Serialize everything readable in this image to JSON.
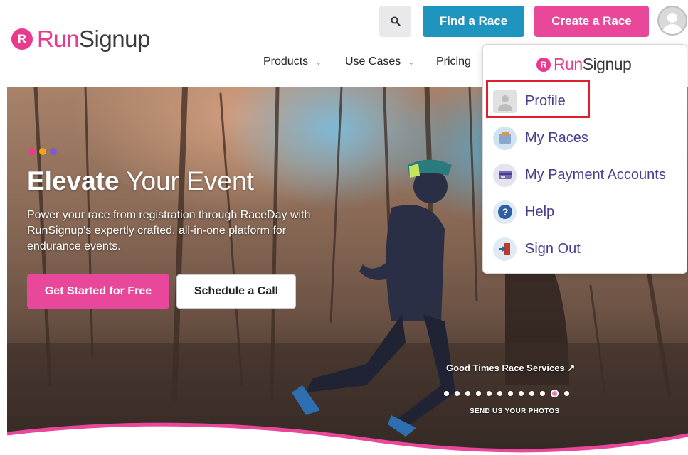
{
  "brand": {
    "run": "Run",
    "signup": "Signup",
    "mark": "R"
  },
  "header": {
    "find_label": "Find a Race",
    "create_label": "Create a Race"
  },
  "nav": {
    "items": [
      {
        "label": "Products"
      },
      {
        "label": "Use Cases"
      },
      {
        "label": "Pricing"
      }
    ]
  },
  "hero": {
    "title_bold": "Elevate",
    "title_rest": " Your Event",
    "text": "Power your race from registration through RaceDay with RunSignup's expertly crafted, all-in-one platform for endurance events.",
    "start_label": "Get Started for Free",
    "call_label": "Schedule a Call",
    "credit": "Good Times Race Services",
    "credit_arrow": "↗",
    "send_photos": "SEND US YOUR PHOTOS",
    "carousel_count": 12,
    "carousel_active": 10,
    "dot_colors": [
      "#e93a8d",
      "#f4a31b",
      "#7b5cc8"
    ]
  },
  "dropdown": {
    "items": [
      {
        "label": "Profile",
        "icon": "profile-icon"
      },
      {
        "label": "My Races",
        "icon": "races-icon"
      },
      {
        "label": "My Payment Accounts",
        "icon": "payment-icon"
      },
      {
        "label": "Help",
        "icon": "help-icon"
      },
      {
        "label": "Sign Out",
        "icon": "sign-out-icon"
      }
    ]
  },
  "colors": {
    "pink": "#e8479a",
    "blue": "#1d95bf",
    "purple": "#4b3c8f",
    "highlight": "#e01e2c"
  }
}
